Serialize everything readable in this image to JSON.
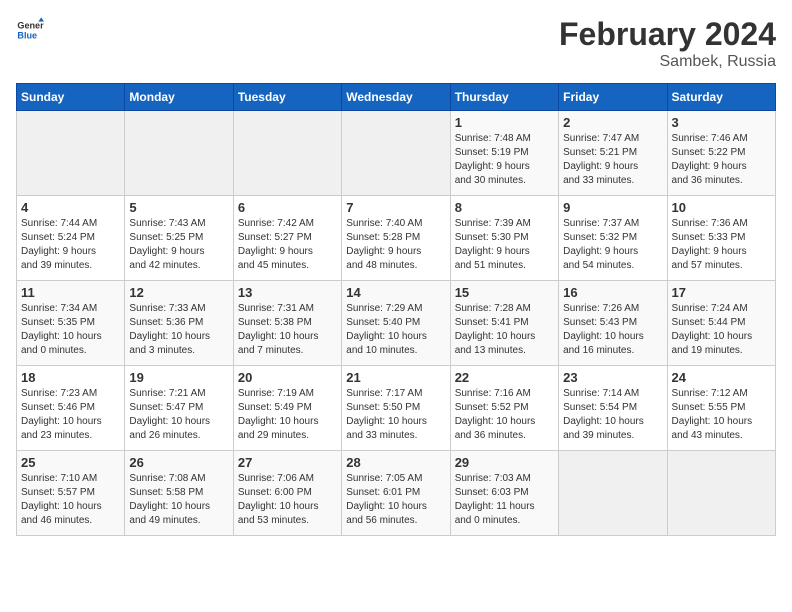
{
  "header": {
    "logo_line1": "General",
    "logo_line2": "Blue",
    "month_year": "February 2024",
    "location": "Sambek, Russia"
  },
  "days_of_week": [
    "Sunday",
    "Monday",
    "Tuesday",
    "Wednesday",
    "Thursday",
    "Friday",
    "Saturday"
  ],
  "weeks": [
    [
      {
        "day": "",
        "info": ""
      },
      {
        "day": "",
        "info": ""
      },
      {
        "day": "",
        "info": ""
      },
      {
        "day": "",
        "info": ""
      },
      {
        "day": "1",
        "info": "Sunrise: 7:48 AM\nSunset: 5:19 PM\nDaylight: 9 hours\nand 30 minutes."
      },
      {
        "day": "2",
        "info": "Sunrise: 7:47 AM\nSunset: 5:21 PM\nDaylight: 9 hours\nand 33 minutes."
      },
      {
        "day": "3",
        "info": "Sunrise: 7:46 AM\nSunset: 5:22 PM\nDaylight: 9 hours\nand 36 minutes."
      }
    ],
    [
      {
        "day": "4",
        "info": "Sunrise: 7:44 AM\nSunset: 5:24 PM\nDaylight: 9 hours\nand 39 minutes."
      },
      {
        "day": "5",
        "info": "Sunrise: 7:43 AM\nSunset: 5:25 PM\nDaylight: 9 hours\nand 42 minutes."
      },
      {
        "day": "6",
        "info": "Sunrise: 7:42 AM\nSunset: 5:27 PM\nDaylight: 9 hours\nand 45 minutes."
      },
      {
        "day": "7",
        "info": "Sunrise: 7:40 AM\nSunset: 5:28 PM\nDaylight: 9 hours\nand 48 minutes."
      },
      {
        "day": "8",
        "info": "Sunrise: 7:39 AM\nSunset: 5:30 PM\nDaylight: 9 hours\nand 51 minutes."
      },
      {
        "day": "9",
        "info": "Sunrise: 7:37 AM\nSunset: 5:32 PM\nDaylight: 9 hours\nand 54 minutes."
      },
      {
        "day": "10",
        "info": "Sunrise: 7:36 AM\nSunset: 5:33 PM\nDaylight: 9 hours\nand 57 minutes."
      }
    ],
    [
      {
        "day": "11",
        "info": "Sunrise: 7:34 AM\nSunset: 5:35 PM\nDaylight: 10 hours\nand 0 minutes."
      },
      {
        "day": "12",
        "info": "Sunrise: 7:33 AM\nSunset: 5:36 PM\nDaylight: 10 hours\nand 3 minutes."
      },
      {
        "day": "13",
        "info": "Sunrise: 7:31 AM\nSunset: 5:38 PM\nDaylight: 10 hours\nand 7 minutes."
      },
      {
        "day": "14",
        "info": "Sunrise: 7:29 AM\nSunset: 5:40 PM\nDaylight: 10 hours\nand 10 minutes."
      },
      {
        "day": "15",
        "info": "Sunrise: 7:28 AM\nSunset: 5:41 PM\nDaylight: 10 hours\nand 13 minutes."
      },
      {
        "day": "16",
        "info": "Sunrise: 7:26 AM\nSunset: 5:43 PM\nDaylight: 10 hours\nand 16 minutes."
      },
      {
        "day": "17",
        "info": "Sunrise: 7:24 AM\nSunset: 5:44 PM\nDaylight: 10 hours\nand 19 minutes."
      }
    ],
    [
      {
        "day": "18",
        "info": "Sunrise: 7:23 AM\nSunset: 5:46 PM\nDaylight: 10 hours\nand 23 minutes."
      },
      {
        "day": "19",
        "info": "Sunrise: 7:21 AM\nSunset: 5:47 PM\nDaylight: 10 hours\nand 26 minutes."
      },
      {
        "day": "20",
        "info": "Sunrise: 7:19 AM\nSunset: 5:49 PM\nDaylight: 10 hours\nand 29 minutes."
      },
      {
        "day": "21",
        "info": "Sunrise: 7:17 AM\nSunset: 5:50 PM\nDaylight: 10 hours\nand 33 minutes."
      },
      {
        "day": "22",
        "info": "Sunrise: 7:16 AM\nSunset: 5:52 PM\nDaylight: 10 hours\nand 36 minutes."
      },
      {
        "day": "23",
        "info": "Sunrise: 7:14 AM\nSunset: 5:54 PM\nDaylight: 10 hours\nand 39 minutes."
      },
      {
        "day": "24",
        "info": "Sunrise: 7:12 AM\nSunset: 5:55 PM\nDaylight: 10 hours\nand 43 minutes."
      }
    ],
    [
      {
        "day": "25",
        "info": "Sunrise: 7:10 AM\nSunset: 5:57 PM\nDaylight: 10 hours\nand 46 minutes."
      },
      {
        "day": "26",
        "info": "Sunrise: 7:08 AM\nSunset: 5:58 PM\nDaylight: 10 hours\nand 49 minutes."
      },
      {
        "day": "27",
        "info": "Sunrise: 7:06 AM\nSunset: 6:00 PM\nDaylight: 10 hours\nand 53 minutes."
      },
      {
        "day": "28",
        "info": "Sunrise: 7:05 AM\nSunset: 6:01 PM\nDaylight: 10 hours\nand 56 minutes."
      },
      {
        "day": "29",
        "info": "Sunrise: 7:03 AM\nSunset: 6:03 PM\nDaylight: 11 hours\nand 0 minutes."
      },
      {
        "day": "",
        "info": ""
      },
      {
        "day": "",
        "info": ""
      }
    ]
  ]
}
